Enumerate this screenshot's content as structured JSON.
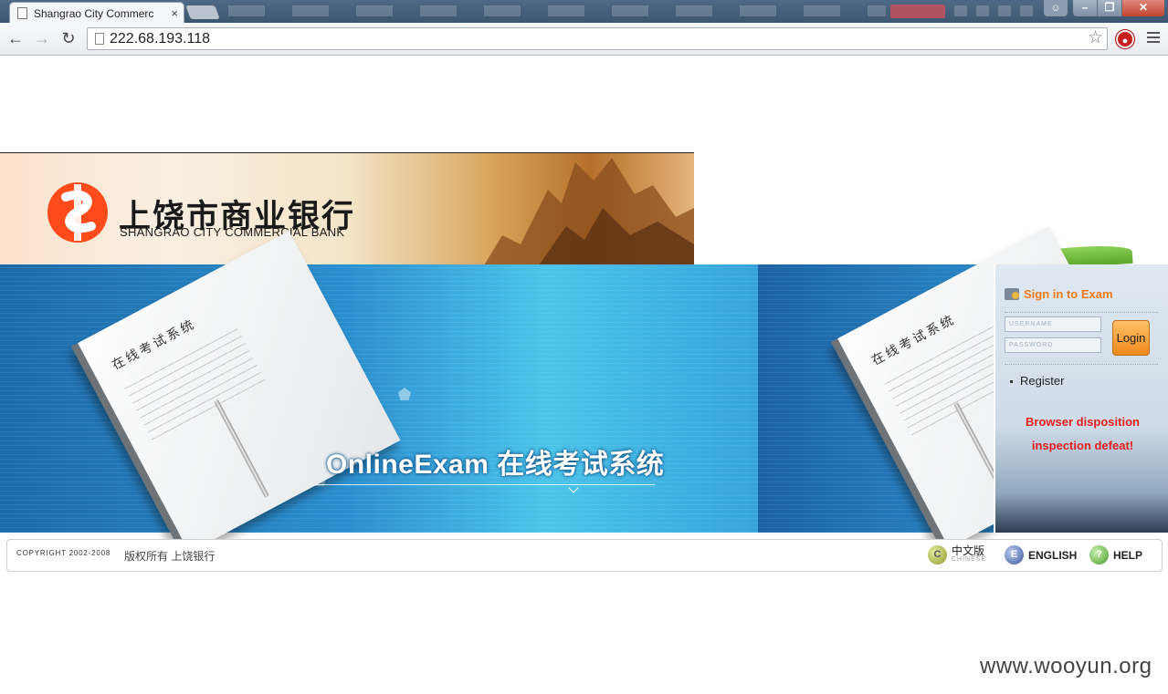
{
  "browser": {
    "tab_title": "Shangrao City Commerc",
    "tab_close": "×",
    "url": "222.68.193.118"
  },
  "header": {
    "logo_cn": "上饶市商业银行",
    "logo_en": "SHANGRAO CITY COMMERCIAL BANK"
  },
  "hero": {
    "title": "OnlineExam 在线考试系统",
    "notebook_text": "在线考试系统"
  },
  "login": {
    "title": "Sign in to Exam",
    "username_placeholder": "USERNAME",
    "password_placeholder": "PASSWORD",
    "login_button": "Login",
    "register_link": "Register",
    "warning_line1": "Browser disposition",
    "warning_line2": "inspection defeat!"
  },
  "footer": {
    "copyright": "COPYRIGHT 2002-2008",
    "copyright_cn": "版权所有 上饶银行",
    "chinese_label": "中文版",
    "chinese_sub": "CHINESE",
    "chinese_icon_letter": "C",
    "english_label": "ENGLISH",
    "english_icon_letter": "E",
    "help_label": "HELP",
    "help_icon_letter": "?"
  },
  "watermark": "www.wooyun.org",
  "colors": {
    "accent_orange": "#f07a19",
    "warning_red": "#e41c1c",
    "hero_blue": "#2b8fcf"
  },
  "icons": [
    "page-icon",
    "back-icon",
    "forward-icon",
    "reload-icon",
    "star-icon",
    "stop-extension-icon",
    "menu-icon",
    "key-icon",
    "chinese-icon",
    "english-icon",
    "help-icon"
  ]
}
